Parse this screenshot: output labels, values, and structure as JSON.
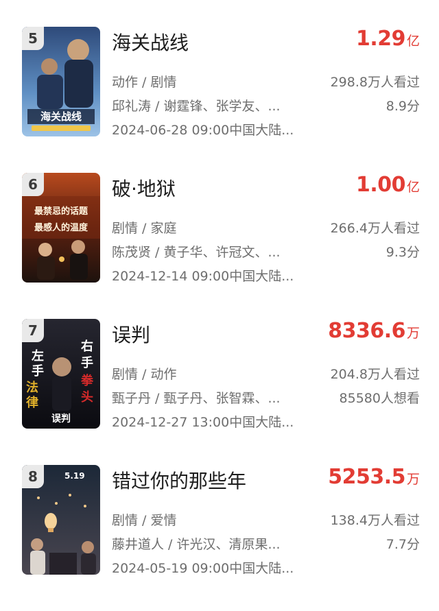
{
  "items": [
    {
      "rank": "5",
      "title": "海关战线",
      "box_number": "1.29",
      "box_unit": "亿",
      "genre": "动作 / 剧情",
      "people": "邱礼涛 / 谢霆锋、张学友、...",
      "release": "2024-06-28 09:00中国大陆...",
      "stat1": "298.8万人看过",
      "stat2": "8.9分",
      "poster_text": "海关战线",
      "poster_colors": {
        "top": "#2e4a7a",
        "bottom": "#9cc2e6",
        "accent": "#f0c64a"
      }
    },
    {
      "rank": "6",
      "title": "破·地狱",
      "box_number": "1.00",
      "box_unit": "亿",
      "genre": "剧情 / 家庭",
      "people": "陈茂贤 / 黄子华、许冠文、...",
      "release": "2024-12-14 09:00中国大陆...",
      "stat1": "266.4万人看过",
      "stat2": "9.3分",
      "poster_text": "最禁忌的话题 最感人的温度",
      "poster_colors": {
        "top": "#7a2a10",
        "bottom": "#1d120d",
        "accent": "#f3e6c8"
      }
    },
    {
      "rank": "7",
      "title": "误判",
      "box_number": "8336.6",
      "box_unit": "万",
      "genre": "剧情 / 动作",
      "people": "甄子丹 / 甄子丹、张智霖、...",
      "release": "2024-12-27 13:00中国大陆...",
      "stat1": "204.8万人看过",
      "stat2": "85580人想看",
      "poster_text": "左手法律 右手拳头",
      "poster_colors": {
        "top": "#1b1b22",
        "bottom": "#0b0b10",
        "accent": "#d42a2a"
      }
    },
    {
      "rank": "8",
      "title": "错过你的那些年",
      "box_number": "5253.5",
      "box_unit": "万",
      "genre": "剧情 / 爱情",
      "people": "藤井道人 / 许光汉、清原果...",
      "release": "2024-05-19 09:00中国大陆...",
      "stat1": "138.4万人看过",
      "stat2": "7.7分",
      "poster_text": "5.19",
      "poster_colors": {
        "top": "#1c2838",
        "bottom": "#3c3a44",
        "accent": "#f2c889"
      }
    }
  ]
}
